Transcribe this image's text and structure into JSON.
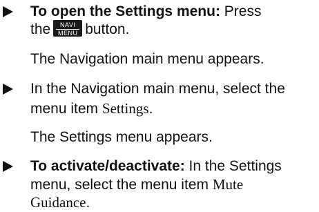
{
  "steps": [
    {
      "bullet_icon": "triangle-right-icon",
      "lead": "To open the Settings menu:",
      "text_1": "Press",
      "text_2a": "the",
      "key_top": "NAVI",
      "key_bottom": "MENU",
      "text_2b": "button.",
      "result": "The Navigation main menu appears."
    },
    {
      "bullet_icon": "triangle-right-icon",
      "text_1": "In the Navigation main menu, select the",
      "text_2a": "menu item",
      "item": "Settings",
      "text_2b": ".",
      "result": "The Settings menu appears."
    },
    {
      "bullet_icon": "triangle-right-icon",
      "lead": "To activate/deactivate:",
      "text_1": "In the Settings",
      "text_2a": "menu, select the menu item",
      "item_1": "Mute",
      "item_2": "Guidance",
      "text_3b": "."
    }
  ]
}
